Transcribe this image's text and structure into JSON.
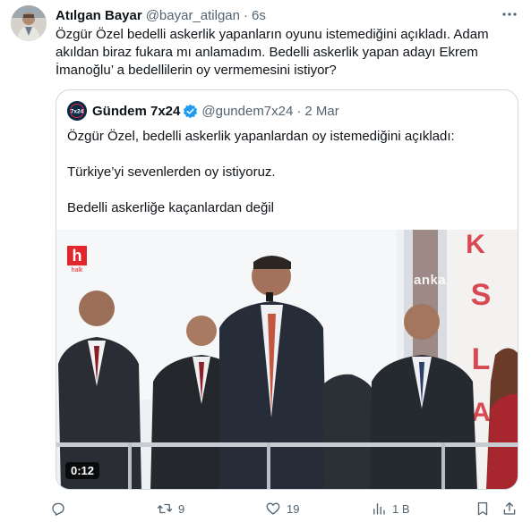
{
  "author": {
    "name": "Atılgan Bayar",
    "handle": "@bayar_atilgan",
    "separator": "·",
    "time": "6s"
  },
  "tweet_text": "Özgür Özel bedelli askerlik yapanların oyunu istemediğini açıkladı. Adam akıldan biraz fukara mı anlamadım. Bedelli askerlik yapan adayı Ekrem İmanoğlu’ a bedellilerin oy vermemesini istiyor?",
  "quoted": {
    "name": "Gündem 7x24",
    "handle": "@gundem7x24",
    "separator": "·",
    "time": "2 Mar",
    "avatar_text": "7x24",
    "lines": [
      "Özgür Özel, bedelli askerlik yapanlardan oy istemediğini açıkladı:",
      "Türkiye’yi sevenlerden oy istiyoruz.",
      "Bedelli askerliğe kaçanlardan değil"
    ],
    "video": {
      "duration": "0:12",
      "watermark_left": "h",
      "watermark_left_sub": "halk",
      "watermark_right": "anka",
      "signage_letters": [
        "K",
        "S",
        "L",
        "A"
      ]
    }
  },
  "actions": {
    "reply_count": "",
    "retweet_count": "9",
    "like_count": "19",
    "views_count": "1 B"
  },
  "colors": {
    "text": "#0f1419",
    "secondary": "#536471",
    "border": "#cfd9de",
    "verified": "#1d9bf0",
    "halk_red": "#e3262b"
  }
}
